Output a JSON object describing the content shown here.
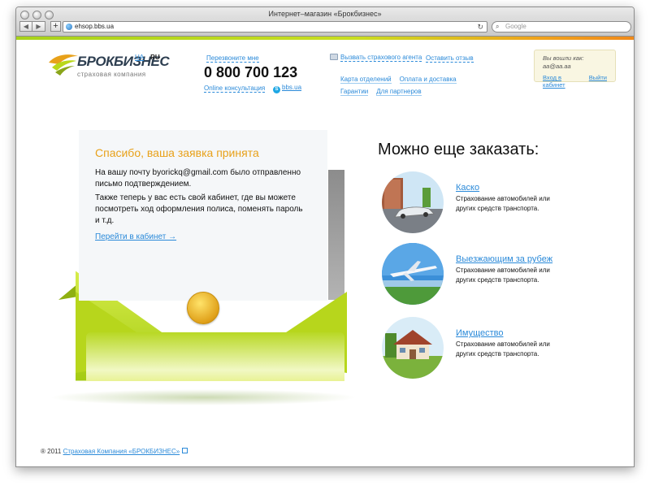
{
  "window": {
    "title": "Интернет–магазин «Брокбизнес»"
  },
  "toolbar": {
    "url": "ehsop.bbs.ua",
    "search_placeholder": "Google"
  },
  "header": {
    "logo_text": "БРОКБИЗНЕС",
    "logo_sub": "страховая компания",
    "lang_ua": "UA",
    "lang_ru": "RU",
    "callback": "Перезвоните мне",
    "phone": "0 800 700 123",
    "consult": "Online консультация",
    "skype": "bbs.ua",
    "agent": "Вызвать страхового агента",
    "review": "Оставить отзыв",
    "links_row1": [
      "Карта отделений",
      "Оплата и доставка"
    ],
    "links_row2": [
      "Гарантии",
      "Для партнеров"
    ],
    "login": {
      "label": "Вы вошли как:",
      "user": "aa@aa.aa",
      "cabinet": "Вход в кабинет",
      "logout": "Выйти"
    }
  },
  "confirmation": {
    "title": "Спасибо, ваша заявка принята",
    "p1": "На вашу почту byorickq@gmail.com было отправленно письмо подтверждением.",
    "p2": "Также теперь у вас есть свой кабинет, где вы можете посмотреть ход оформления полиса, поменять пароль и т.д.",
    "link": "Перейти в кабинет →"
  },
  "more": {
    "title": "Можно еще заказать:",
    "offers": [
      {
        "title": "Каско",
        "desc": "Страхование автомобилей или других средств транспорта.",
        "icon": "car-icon"
      },
      {
        "title": "Выезжающим за рубеж",
        "desc": "Страхование автомобилей или других средств транспорта.",
        "icon": "airplane-icon"
      },
      {
        "title": "Имущество",
        "desc": "Страхование автомобилей или других средств транспорта.",
        "icon": "house-icon"
      }
    ]
  },
  "footer": {
    "copy": "® 2011",
    "company": "Страховая Компания «БРОКБИЗНЕС»"
  },
  "colors": {
    "accent": "#2b8ad9",
    "green": "#b9d81a",
    "orange": "#e8a11a"
  }
}
